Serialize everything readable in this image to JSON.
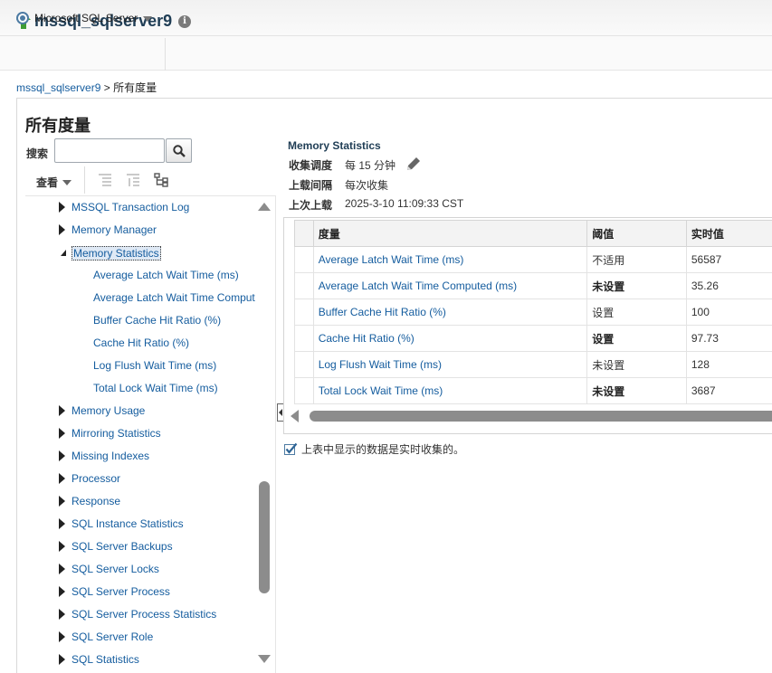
{
  "header": {
    "title": "mssql_sqlserver9"
  },
  "menu": {
    "target_menu_label": "Microsoft SQL Server"
  },
  "breadcrumb": {
    "parent": "mssql_sqlserver9",
    "separator": ">",
    "current": "所有度量"
  },
  "page": {
    "title": "所有度量"
  },
  "search": {
    "label": "搜索",
    "value": ""
  },
  "toolbar": {
    "view_label": "查看"
  },
  "tree": {
    "items": [
      {
        "label": "MSSQL Transaction Log",
        "level": 0,
        "state": "collapsed"
      },
      {
        "label": "Memory Manager",
        "level": 0,
        "state": "collapsed"
      },
      {
        "label": "Memory Statistics",
        "level": 0,
        "state": "expanded",
        "selected": true
      },
      {
        "label": "Average Latch Wait Time (ms)",
        "level": 1
      },
      {
        "label": "Average Latch Wait Time Comput",
        "level": 1
      },
      {
        "label": "Buffer Cache Hit Ratio (%)",
        "level": 1
      },
      {
        "label": "Cache Hit Ratio (%)",
        "level": 1
      },
      {
        "label": "Log Flush Wait Time (ms)",
        "level": 1
      },
      {
        "label": "Total Lock Wait Time (ms)",
        "level": 1
      },
      {
        "label": "Memory Usage",
        "level": 0,
        "state": "collapsed"
      },
      {
        "label": "Mirroring Statistics",
        "level": 0,
        "state": "collapsed"
      },
      {
        "label": "Missing Indexes",
        "level": 0,
        "state": "collapsed"
      },
      {
        "label": "Processor",
        "level": 0,
        "state": "collapsed"
      },
      {
        "label": "Response",
        "level": 0,
        "state": "collapsed"
      },
      {
        "label": "SQL Instance Statistics",
        "level": 0,
        "state": "collapsed"
      },
      {
        "label": "SQL Server Backups",
        "level": 0,
        "state": "collapsed"
      },
      {
        "label": "SQL Server Locks",
        "level": 0,
        "state": "collapsed"
      },
      {
        "label": "SQL Server Process",
        "level": 0,
        "state": "collapsed"
      },
      {
        "label": "SQL Server Process Statistics",
        "level": 0,
        "state": "collapsed"
      },
      {
        "label": "SQL Server Role",
        "level": 0,
        "state": "collapsed"
      },
      {
        "label": "SQL Statistics",
        "level": 0,
        "state": "collapsed"
      }
    ]
  },
  "details": {
    "title": "Memory Statistics",
    "schedule_label": "收集调度",
    "schedule_value": "每 15 分钟",
    "upload_interval_label": "上载间隔",
    "upload_interval_value": "每次收集",
    "last_upload_label": "上次上载",
    "last_upload_value": "2025-3-10 11:09:33 CST"
  },
  "table": {
    "columns": [
      "度量",
      "阈值",
      "实时值"
    ],
    "rows": [
      {
        "metric": "Average Latch Wait Time (ms)",
        "threshold": "不适用",
        "threshold_bold": false,
        "value": "56587"
      },
      {
        "metric": "Average Latch Wait Time Computed (ms)",
        "threshold": "未设置",
        "threshold_bold": true,
        "value": "35.26"
      },
      {
        "metric": "Buffer Cache Hit Ratio (%)",
        "threshold": "设置",
        "threshold_bold": false,
        "value": "100"
      },
      {
        "metric": "Cache Hit Ratio (%)",
        "threshold": "设置",
        "threshold_bold": true,
        "value": "97.73"
      },
      {
        "metric": "Log Flush Wait Time (ms)",
        "threshold": "未设置",
        "threshold_bold": false,
        "value": "128"
      },
      {
        "metric": "Total Lock Wait Time (ms)",
        "threshold": "未设置",
        "threshold_bold": true,
        "value": "3687"
      }
    ]
  },
  "note": {
    "text": "上表中显示的数据是实时收集的。"
  },
  "colors": {
    "link": "#145c9e",
    "up_arrow": "#3f9c35",
    "title": "#1f3d55"
  }
}
